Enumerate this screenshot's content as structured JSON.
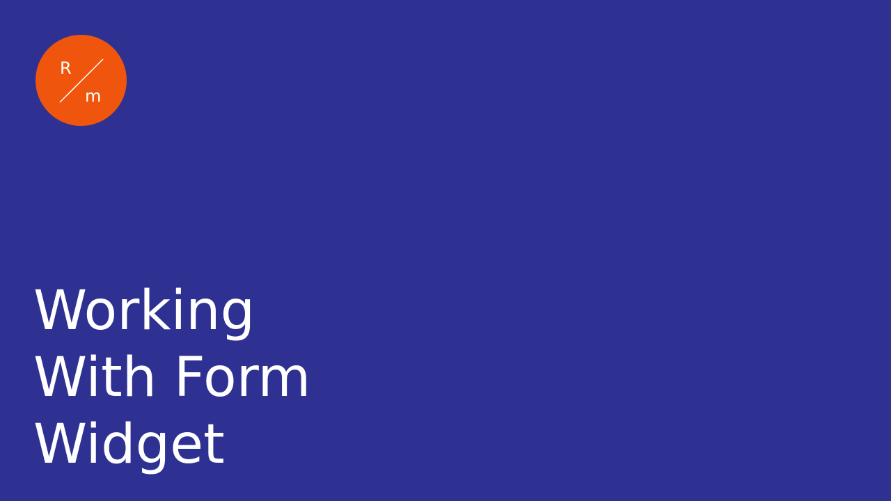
{
  "logo": {
    "name": "rm-logo",
    "letter_top": "R",
    "letter_bottom": "m",
    "background_color": "#f0550e"
  },
  "title": {
    "lines": [
      "Working",
      "With Form",
      "Widget"
    ]
  },
  "colors": {
    "background": "#2e3192",
    "text": "#ffffff"
  }
}
